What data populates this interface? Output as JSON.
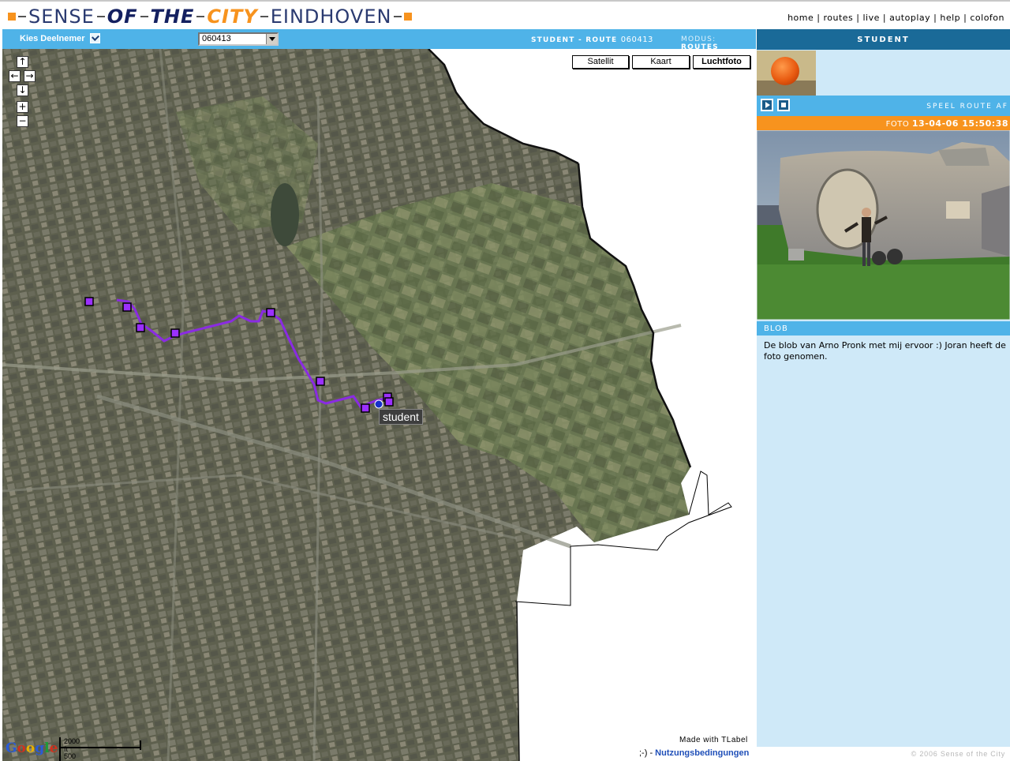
{
  "header": {
    "logo": {
      "sense": "SENSE",
      "of": "OF",
      "the": "THE",
      "city": "CITY",
      "eindhoven": "EINDHOVEN"
    },
    "nav": [
      "home",
      "routes",
      "live",
      "autoplay",
      "help",
      "colofon"
    ]
  },
  "mapbar": {
    "kies_label": "Kies Deelnemer",
    "select_value": "060413",
    "route_prefix": "STUDENT - ROUTE",
    "route_num": "060413",
    "modus_label": "MODUS:",
    "modus_value": "ROUTES"
  },
  "map": {
    "buttons": {
      "satellite": "Satellit",
      "map": "Kaart",
      "aerial": "Luchtfoto"
    },
    "nav_icons": {
      "up": "↑",
      "left": "←",
      "right": "→",
      "down": "↓",
      "zoom_in": "+",
      "zoom_out": "−"
    },
    "marker_label": "student",
    "made_with": "Made with TLabel",
    "scale_ft": "2000 ft",
    "scale_m": "500 m",
    "google": [
      "G",
      "o",
      "o",
      "g",
      "l",
      "e"
    ],
    "footer_prefix": ";-) -",
    "footer_link": "Nutzungsbedingungen",
    "route_color": "#8a2be2",
    "waypoint_color": "#9b30ff"
  },
  "sidebar": {
    "title": "STUDENT",
    "speel": "SPEEL ROUTE AF",
    "foto_label": "FOTO",
    "foto_date": "13-04-06 15:50:38",
    "blob_label": "BLOB",
    "blob_text": "De blob van Arno Pronk met mij ervoor :) Joran heeft de foto genomen.",
    "copyright": "© 2006 Sense of the City"
  },
  "colors": {
    "accent_blue": "#4fb3e8",
    "dark_blue": "#1a6a98",
    "orange": "#f7931e",
    "panel": "#cfe9f8"
  }
}
